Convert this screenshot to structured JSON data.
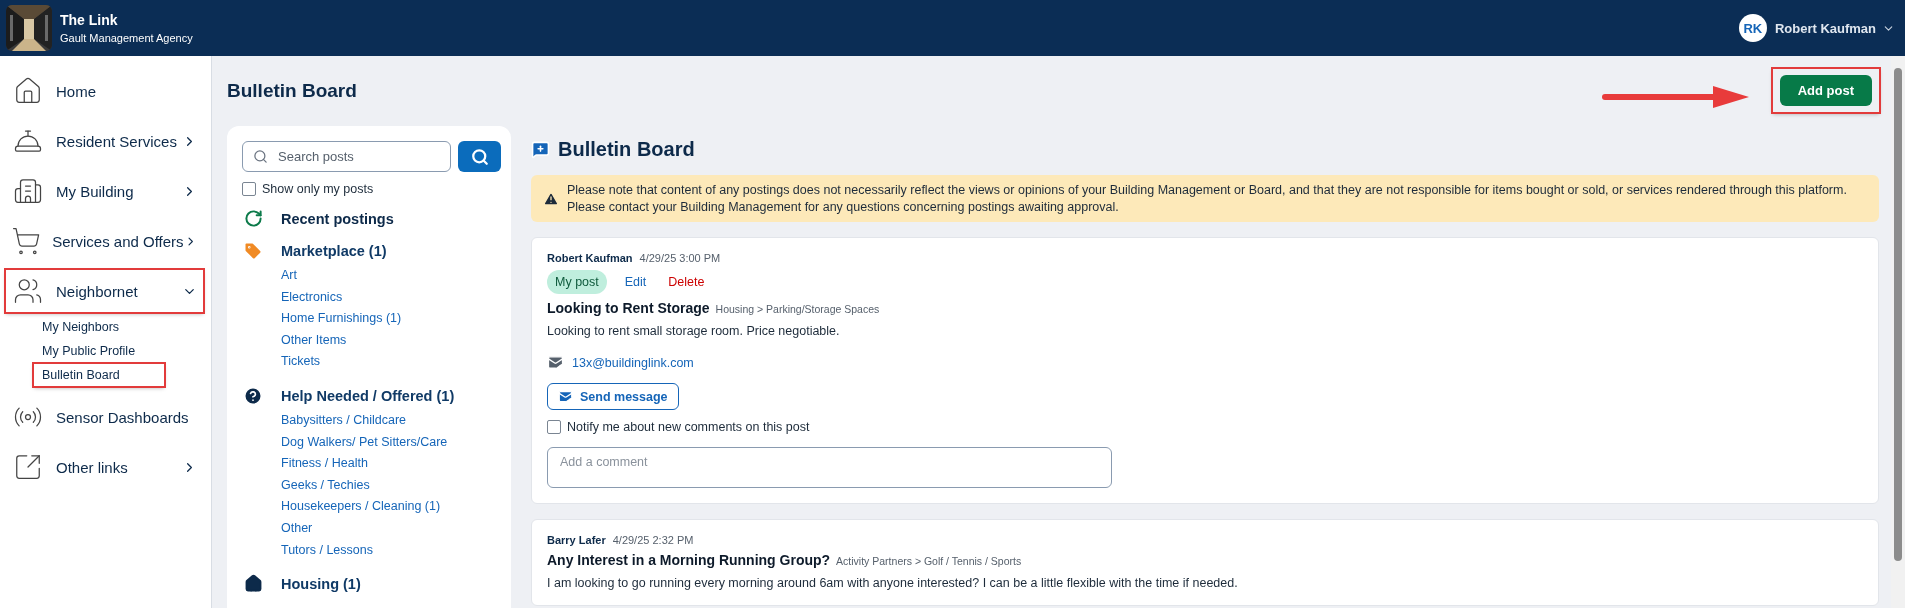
{
  "app": {
    "title": "The Link",
    "subtitle": "Gault Management Agency"
  },
  "user": {
    "initials": "RK",
    "name": "Robert Kaufman"
  },
  "sidebar": {
    "items": [
      {
        "label": "Home",
        "kind": "link",
        "highlighted": false
      },
      {
        "label": "Resident Services",
        "kind": "group",
        "expanded": false,
        "highlighted": false
      },
      {
        "label": "My Building",
        "kind": "group",
        "expanded": false,
        "highlighted": false
      },
      {
        "label": "Services and Offers",
        "kind": "group",
        "expanded": false,
        "highlighted": false
      },
      {
        "label": "Neighbornet",
        "kind": "group",
        "expanded": true,
        "highlighted": true,
        "children": [
          {
            "label": "My Neighbors",
            "highlighted": false
          },
          {
            "label": "My Public Profile",
            "highlighted": false
          },
          {
            "label": "Bulletin Board",
            "highlighted": true
          }
        ]
      },
      {
        "label": "Sensor Dashboards",
        "kind": "link",
        "highlighted": false
      },
      {
        "label": "Other links",
        "kind": "group",
        "expanded": false,
        "highlighted": false
      }
    ]
  },
  "page_title": "Bulletin Board",
  "add_post": {
    "label": "Add post",
    "highlighted": true,
    "pointer_arrow": true
  },
  "filters": {
    "search": {
      "placeholder": "Search posts"
    },
    "show_mine": {
      "label": "Show only my posts",
      "checked": false
    },
    "categories": [
      {
        "label": "Recent postings",
        "kind": "recent"
      },
      {
        "label": "Marketplace (1)",
        "kind": "marketplace",
        "children": [
          "Art",
          "Electronics",
          "Home Furnishings (1)",
          "Other Items",
          "Tickets"
        ]
      },
      {
        "label": "Help Needed / Offered (1)",
        "kind": "help",
        "children": [
          "Babysitters / Childcare",
          "Dog Walkers/ Pet Sitters/Care",
          "Fitness / Health",
          "Geeks / Techies",
          "Housekeepers / Cleaning (1)",
          "Other",
          "Tutors / Lessons"
        ]
      },
      {
        "label": "Housing (1)",
        "kind": "housing"
      }
    ]
  },
  "board": {
    "title": "Bulletin Board",
    "notice": [
      "Please note that content of any postings does not necessarily reflect the views or opinions of your Building Management or Board, and that they are not responsible for items bought or sold, or services rendered through this platform.",
      "Please contact your Building Management for any questions concerning postings awaiting approval."
    ],
    "posts": [
      {
        "author": "Robert Kaufman",
        "time": "4/29/25 3:00 PM",
        "mine": true,
        "badge": "My post",
        "actions": [
          {
            "label": "Edit",
            "kind": "edit"
          },
          {
            "label": "Delete",
            "kind": "delete"
          }
        ],
        "title": "Looking to Rent Storage",
        "category": "Housing > Parking/Storage Spaces",
        "body": "Looking to rent small storage room. Price negotiable.",
        "email": "13x@buildinglink.com",
        "send_label": "Send message",
        "notify": {
          "label": "Notify me about new comments on this post",
          "checked": false
        },
        "comment_placeholder": "Add a comment"
      },
      {
        "author": "Barry Lafer",
        "time": "4/29/25 2:32 PM",
        "mine": false,
        "title": "Any Interest in a Morning Running Group?",
        "category": "Activity Partners > Golf / Tennis / Sports",
        "body": "I am looking to go running every morning around 6am with anyone interested? I can be a little flexible with the time if needed."
      }
    ]
  }
}
